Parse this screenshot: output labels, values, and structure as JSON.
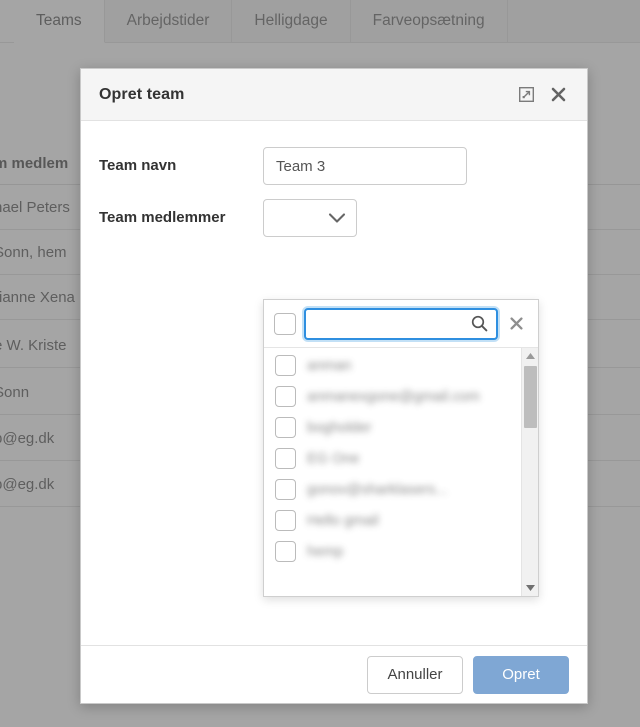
{
  "background": {
    "tabs": [
      {
        "label": "Teams",
        "active": true
      },
      {
        "label": "Arbejdstider",
        "active": false
      },
      {
        "label": "Helligdage",
        "active": false
      },
      {
        "label": "Farveopsætning",
        "active": false
      }
    ],
    "table": {
      "header": "m medlem",
      "rows": [
        "hael Peters",
        "Sonn, hem",
        "rianne Xena",
        "e W. Kriste",
        "Sonn",
        "p@eg.dk",
        "p@eg.dk"
      ]
    }
  },
  "modal": {
    "title": "Opret team",
    "header_icons": {
      "maximize": "maximize-icon",
      "close": "close-icon"
    },
    "fields": {
      "team_name": {
        "label": "Team navn",
        "value": "Team 3",
        "placeholder": ""
      },
      "team_members": {
        "label": "Team medlemmer",
        "selected": ""
      }
    },
    "dropdown": {
      "search_value": "",
      "search_placeholder": "",
      "search_icon": "search-icon",
      "clear_icon": "clear-icon",
      "select_all_checked": false,
      "items": [
        {
          "label": "anman",
          "checked": false
        },
        {
          "label": "anmanexgone@gmail.com",
          "checked": false
        },
        {
          "label": "bogholder",
          "checked": false
        },
        {
          "label": "EG One",
          "checked": false
        },
        {
          "label": "gonov@sharklasers...",
          "checked": false
        },
        {
          "label": "Hello gmail",
          "checked": false
        },
        {
          "label": "hemp",
          "checked": false
        }
      ],
      "scrollbar": {
        "up_arrow": "caret-up-icon",
        "down_arrow": "caret-down-icon"
      }
    },
    "footer": {
      "cancel_label": "Annuller",
      "create_label": "Opret"
    }
  },
  "colors": {
    "primary_button": "#7fa7d4",
    "focus_border": "#2f8fe0",
    "overlay": "rgba(110,110,110,0.62)"
  }
}
